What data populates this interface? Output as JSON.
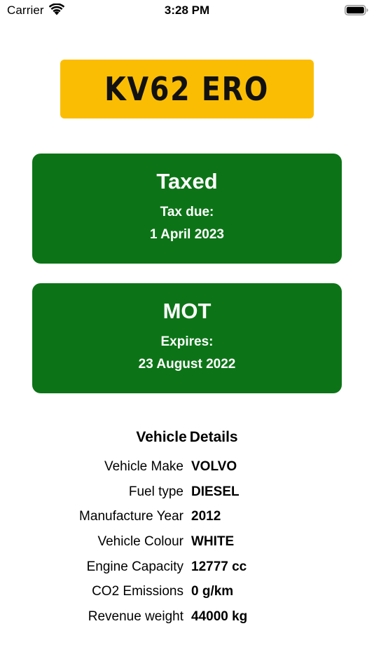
{
  "status_bar": {
    "carrier": "Carrier",
    "time": "3:28 PM",
    "wifi_icon": "wifi-icon",
    "battery_icon": "battery-icon"
  },
  "plate": {
    "registration": "KV62 ERO",
    "color": "#fbbd04"
  },
  "tax": {
    "title": "Taxed",
    "label": "Tax due:",
    "date": "1 April 2023",
    "color": "#0c7417"
  },
  "mot": {
    "title": "MOT",
    "label": "Expires:",
    "date": "23 August 2022",
    "color": "#0c7417"
  },
  "details": {
    "title_part1": "Vehicle",
    "title_part2": "Details",
    "rows": [
      {
        "label": "Vehicle Make",
        "value": "VOLVO"
      },
      {
        "label": "Fuel type",
        "value": "DIESEL"
      },
      {
        "label": "Manufacture Year",
        "value": "2012"
      },
      {
        "label": "Vehicle Colour",
        "value": "WHITE"
      },
      {
        "label": "Engine Capacity",
        "value": "12777 cc"
      },
      {
        "label": "CO2 Emissions",
        "value": "0 g/km"
      },
      {
        "label": "Revenue weight",
        "value": "44000 kg"
      }
    ]
  }
}
